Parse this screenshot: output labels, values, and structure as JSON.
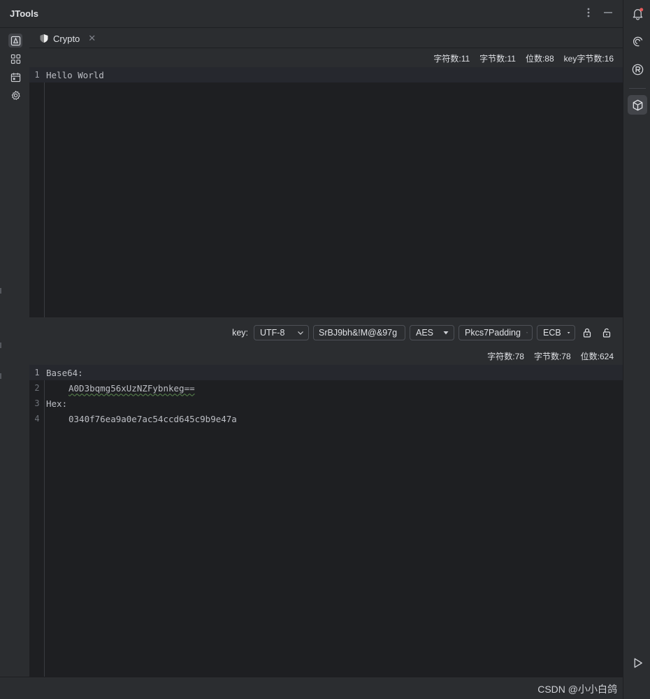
{
  "app": {
    "title": "JTools"
  },
  "title_actions": {
    "more_icon": "more-vertical-icon",
    "minimize_icon": "minimize-icon"
  },
  "left_sidebar": {
    "items": [
      {
        "icon": "crypto-tool-icon",
        "active": true
      },
      {
        "icon": "grid-icon",
        "active": false
      },
      {
        "icon": "calendar-icon",
        "active": false
      },
      {
        "icon": "settings-gear-icon",
        "active": false
      }
    ]
  },
  "right_sidebar": {
    "items": [
      {
        "icon": "notification-bell-icon",
        "badge": true
      },
      {
        "icon": "ai-assistant-spiral-icon"
      },
      {
        "icon": "r-badge-icon"
      },
      {
        "icon": "cube-plugin-icon",
        "active": true
      },
      {
        "icon": "run-play-icon"
      }
    ]
  },
  "tab": {
    "label": "Crypto",
    "icon": "shield-icon",
    "close": "✕"
  },
  "input_stats": {
    "chars": "字符数:11",
    "bytes": "字节数:11",
    "bits": "位数:88",
    "key_bytes": "key字节数:16"
  },
  "input_editor": {
    "lines": [
      {
        "number": "1",
        "text": "Hello World"
      }
    ]
  },
  "controls": {
    "key_label": "key:",
    "encoding": "UTF-8",
    "key_value": "SrBJ9bh&!M@&97g",
    "algorithm": "AES",
    "padding": "Pkcs7Padding",
    "mode": "ECB",
    "encrypt_icon": "lock-icon",
    "decrypt_icon": "unlock-icon"
  },
  "output_stats": {
    "chars": "字符数:78",
    "bytes": "字节数:78",
    "bits": "位数:624"
  },
  "output_editor": {
    "lines": [
      {
        "number": "1",
        "text": "Base64:"
      },
      {
        "number": "2",
        "text": "A0D3bqmg56xUzNZFybnkeg=="
      },
      {
        "number": "3",
        "text": "Hex:"
      },
      {
        "number": "4",
        "text": "0340f76ea9a0e7ac54ccd645c9b9e47a"
      }
    ]
  },
  "watermark": "CSDN @小小白鸽",
  "colors": {
    "background": "#2b2d30",
    "editor_bg": "#1e1f22",
    "text": "#dfe1e5",
    "notification_badge": "#e55b5b"
  }
}
